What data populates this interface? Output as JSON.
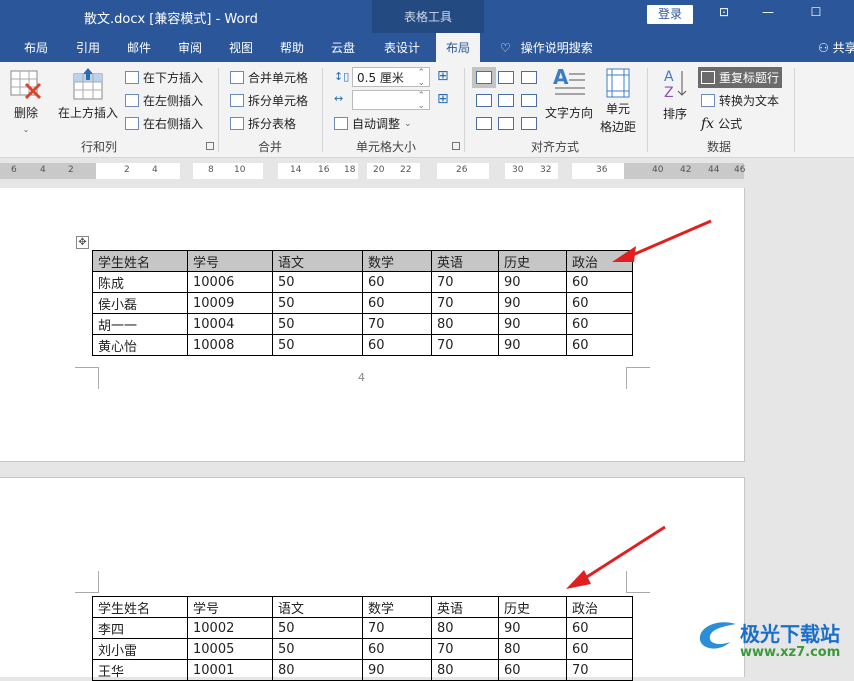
{
  "window": {
    "title": "散文.docx [兼容模式]  -  Word",
    "context_group": "表格工具",
    "login_label": "登录",
    "controls": {
      "ribbon_display": "⊡",
      "minimize": "—",
      "maximize": "☐"
    }
  },
  "tabs": [
    {
      "label": "布局"
    },
    {
      "label": "引用"
    },
    {
      "label": "邮件"
    },
    {
      "label": "审阅"
    },
    {
      "label": "视图"
    },
    {
      "label": "帮助"
    },
    {
      "label": "云盘"
    },
    {
      "label": "表设计"
    },
    {
      "label": "布局",
      "active": true
    }
  ],
  "tell_me": "操作说明搜索",
  "share": "共享",
  "ribbon": {
    "rows_cols": {
      "label": "行和列",
      "delete": "删除",
      "insert_above": "在上方插入",
      "insert_below": "在下方插入",
      "insert_left": "在左侧插入",
      "insert_right": "在右侧插入"
    },
    "merge": {
      "label": "合并",
      "merge_cells": "合并单元格",
      "split_cells": "拆分单元格",
      "split_table": "拆分表格"
    },
    "cell_size": {
      "label": "单元格大小",
      "height_value": "0.5 厘米",
      "width_value": "",
      "autofit": "自动调整"
    },
    "alignment": {
      "label": "对齐方式",
      "text_direction": "文字方向",
      "cell_margins_1": "单元",
      "cell_margins_2": "格边距"
    },
    "data": {
      "label": "数据",
      "sort": "排序",
      "repeat_header": "重复标题行",
      "convert_to_text": "转换为文本",
      "formula": "公式"
    }
  },
  "ruler": {
    "ticks": [
      "6",
      "4",
      "2",
      "2",
      "4",
      "8",
      "10",
      "14",
      "16",
      "18",
      "20",
      "22",
      "26",
      "30",
      "32",
      "36",
      "40",
      "42",
      "44",
      "46"
    ]
  },
  "page1": {
    "page_number": "4",
    "table": {
      "headers": [
        "学生姓名",
        "学号",
        "语文",
        "数学",
        "英语",
        "历史",
        "政治"
      ],
      "rows": [
        [
          "陈成",
          "10006",
          "50",
          "60",
          "70",
          "90",
          "60"
        ],
        [
          "侯小磊",
          "10009",
          "50",
          "60",
          "70",
          "90",
          "60"
        ],
        [
          "胡一一",
          "10004",
          "50",
          "70",
          "80",
          "90",
          "60"
        ],
        [
          "黄心怡",
          "10008",
          "50",
          "60",
          "70",
          "90",
          "60"
        ]
      ]
    }
  },
  "page2": {
    "table": {
      "headers": [
        "学生姓名",
        "学号",
        "语文",
        "数学",
        "英语",
        "历史",
        "政治"
      ],
      "rows": [
        [
          "李四",
          "10002",
          "50",
          "70",
          "80",
          "90",
          "60"
        ],
        [
          "刘小雷",
          "10005",
          "50",
          "60",
          "70",
          "80",
          "60"
        ],
        [
          "王华",
          "10001",
          "80",
          "90",
          "80",
          "60",
          "70"
        ]
      ]
    }
  },
  "watermark": {
    "name": "极光下载站",
    "url": "www.xz7.com"
  },
  "colors": {
    "brand": "#2b579a",
    "arrow": "#e02020",
    "header_fill": "#c6c6c6"
  }
}
